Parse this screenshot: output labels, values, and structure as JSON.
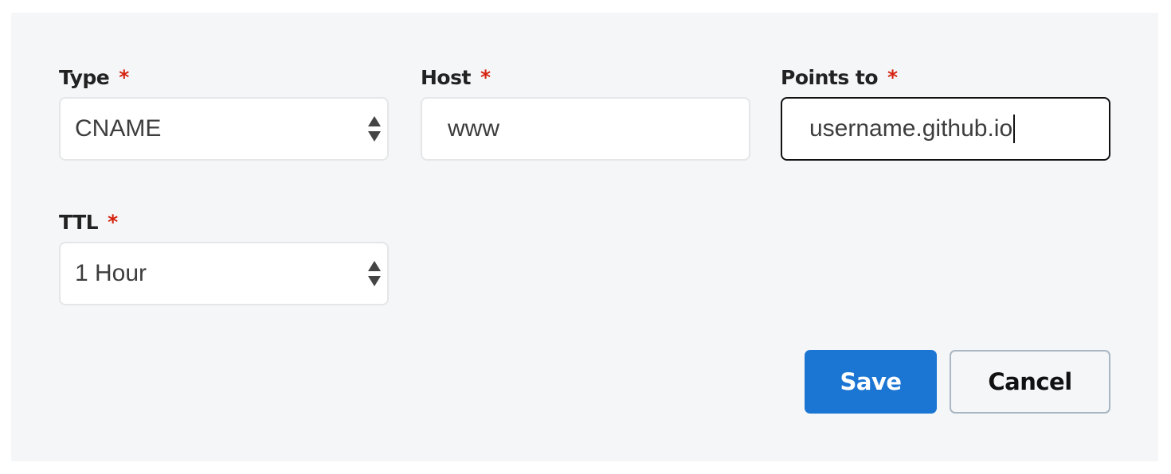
{
  "form": {
    "required_marker": "*",
    "type": {
      "label": "Type",
      "value": "CNAME"
    },
    "host": {
      "label": "Host",
      "value": "www"
    },
    "points_to": {
      "label": "Points to",
      "value": "username.github.io"
    },
    "ttl": {
      "label": "TTL",
      "value": "1 Hour"
    }
  },
  "actions": {
    "save_label": "Save",
    "cancel_label": "Cancel"
  },
  "colors": {
    "accent": "#1b76d3",
    "required": "#d6220e",
    "panel_bg": "#f5f6f8"
  }
}
